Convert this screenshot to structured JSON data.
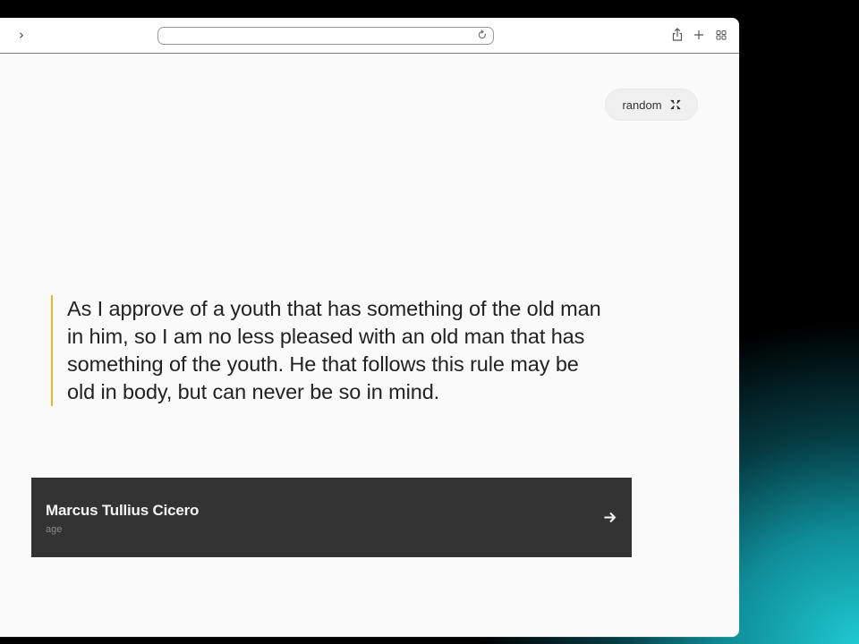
{
  "toolbar": {
    "back_glyph": "‹",
    "forward_glyph": "›",
    "address_value": "",
    "icons": {
      "reload": "reload-icon",
      "share": "share-icon",
      "new_tab": "plus-icon",
      "tabs": "tab-overview-icon"
    }
  },
  "random_button": {
    "label": "random",
    "icon": "shuffle-icon"
  },
  "quote": {
    "text": "As I approve of a youth that has something of the old man in him, so I am no less pleased with an old man that has something of the youth. He that follows this rule may be old in body, but can never be so in mind."
  },
  "author": {
    "name": "Marcus Tullius Cicero",
    "topic": "age",
    "icon": "arrow-right-icon"
  },
  "colors": {
    "accent": "#f2b824",
    "card_background": "#333333",
    "page_background": "#fafafa"
  }
}
